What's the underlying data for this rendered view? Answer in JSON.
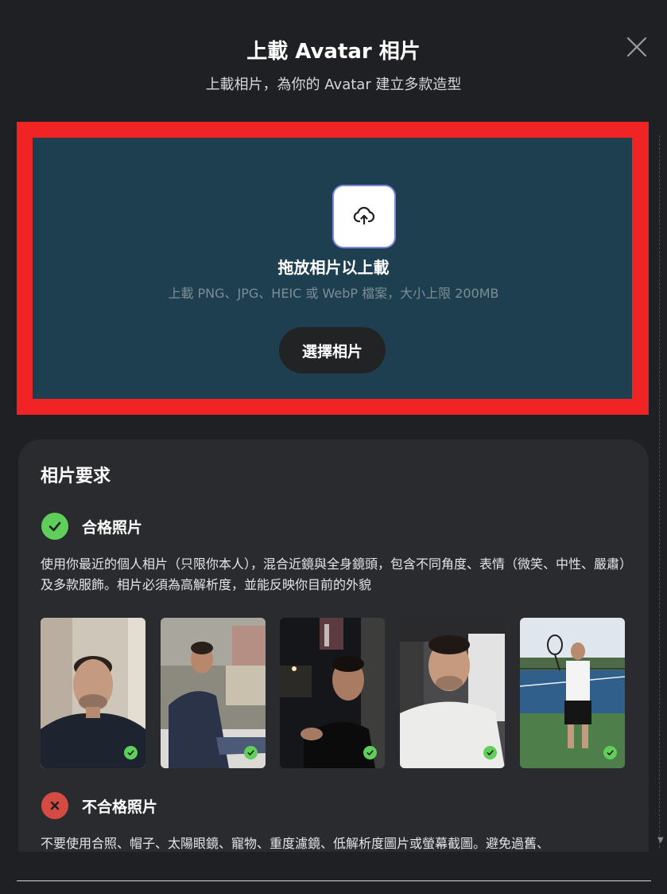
{
  "header": {
    "title": "上載 Avatar 相片",
    "subtitle": "上載相片，為你的 Avatar 建立多款造型"
  },
  "upload": {
    "drop_title": "拖放相片以上載",
    "hint": "上載 PNG、JPG、HEIC 或 WebP 檔案，大小上限 200MB",
    "choose_button": "選擇相片"
  },
  "requirements": {
    "title": "相片要求",
    "good": {
      "label": "合格照片",
      "description": "使用你最近的個人相片（只限你本人），混合近鏡與全身鏡頭，包含不同角度、表情（微笑、中性、嚴肅）及多款服飾。相片必須為高解析度，並能反映你目前的外貌"
    },
    "bad": {
      "label": "不合格照片",
      "description": "不要使用合照、帽子、太陽眼鏡、寵物、重度濾鏡、低解析度圖片或螢幕截圖。避免過舊、"
    }
  },
  "colors": {
    "background": "#1f2023",
    "upload_zone": "#1d3f4f",
    "highlight_border": "#f02424",
    "good": "#5fcf5a",
    "bad": "#d54b44",
    "card": "#2a2b2f"
  },
  "icons": {
    "close": "close-icon",
    "upload": "cloud-upload-icon",
    "good": "check-circle-icon",
    "bad": "x-circle-icon"
  }
}
